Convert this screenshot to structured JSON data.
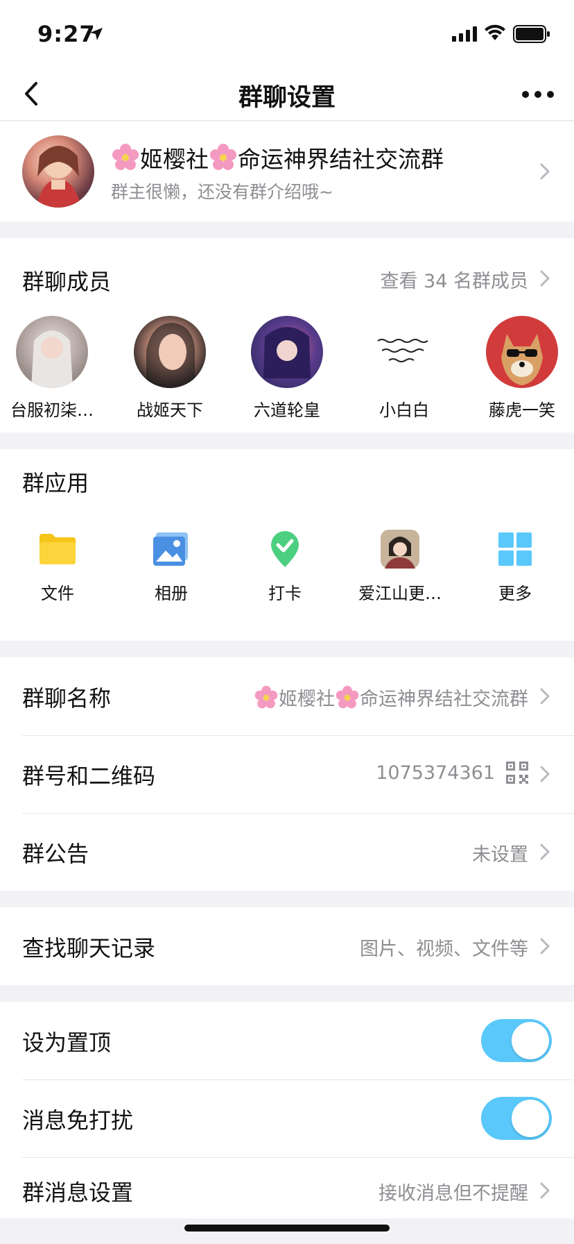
{
  "status_bar": {
    "time": "9:27",
    "icons": [
      "location-arrow-icon",
      "cellular-signal-icon",
      "wifi-icon",
      "battery-icon"
    ]
  },
  "nav": {
    "title": "群聊设置",
    "back_icon": "chevron-left-icon",
    "more_icon": "more-dots-icon"
  },
  "group": {
    "name_part1": "姬樱社",
    "name_part2": "命运神界结社交流群",
    "flower_icon": "cherry-blossom-emoji",
    "intro": "群主很懒，还没有群介绍哦~"
  },
  "members": {
    "title": "群聊成员",
    "view_all": "查看 34 名群成员",
    "list": [
      {
        "name": "台服初柒…"
      },
      {
        "name": "战姬天下"
      },
      {
        "name": "六道轮皇"
      },
      {
        "name": "小白白"
      },
      {
        "name": "藤虎一笑"
      }
    ]
  },
  "apps": {
    "title": "群应用",
    "list": [
      {
        "label": "文件",
        "icon": "folder-icon"
      },
      {
        "label": "相册",
        "icon": "photo-album-icon"
      },
      {
        "label": "打卡",
        "icon": "checkin-pin-icon"
      },
      {
        "label": "爱江山更…",
        "icon": "game-avatar-icon"
      },
      {
        "label": "更多",
        "icon": "grid-more-icon"
      }
    ]
  },
  "info": {
    "name_label": "群聊名称",
    "name_value_part1": "姬樱社",
    "name_value_part2": "命运神界结社交流群",
    "number_label": "群号和二维码",
    "number_value": "1075374361",
    "notice_label": "群公告",
    "notice_value": "未设置"
  },
  "search": {
    "label": "查找聊天记录",
    "value": "图片、视频、文件等"
  },
  "settings": {
    "pin_label": "设为置顶",
    "pin_on": true,
    "dnd_label": "消息免打扰",
    "dnd_on": true,
    "msg_label": "群消息设置",
    "msg_value": "接收消息但不提醒"
  },
  "colors": {
    "toggle_on": "#5ac8fa",
    "secondary_text": "#8e8e93",
    "background": "#f2f2f6"
  }
}
